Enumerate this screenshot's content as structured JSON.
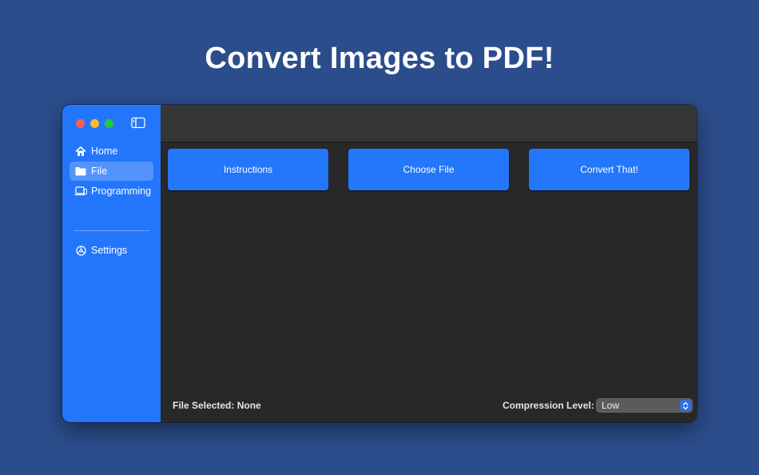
{
  "headline": "Convert Images to PDF!",
  "sidebar": {
    "items": [
      {
        "label": "Home",
        "icon": "house-icon"
      },
      {
        "label": "File",
        "icon": "folder-icon",
        "selected": true
      },
      {
        "label": "Programming",
        "icon": "laptop-icon"
      }
    ],
    "footer_items": [
      {
        "label": "Settings",
        "icon": "gear-icon"
      }
    ]
  },
  "main": {
    "buttons": {
      "instructions": "Instructions",
      "choose_file": "Choose File",
      "convert": "Convert That!"
    },
    "status": {
      "file_selected": "File Selected: None"
    },
    "compression": {
      "label": "Compression Level:",
      "value": "Low"
    }
  },
  "colors": {
    "background": "#2c4d8c",
    "sidebar": "#2376fb",
    "accent_button": "#2377fb",
    "content": "#282828",
    "toolbar": "#363636"
  }
}
